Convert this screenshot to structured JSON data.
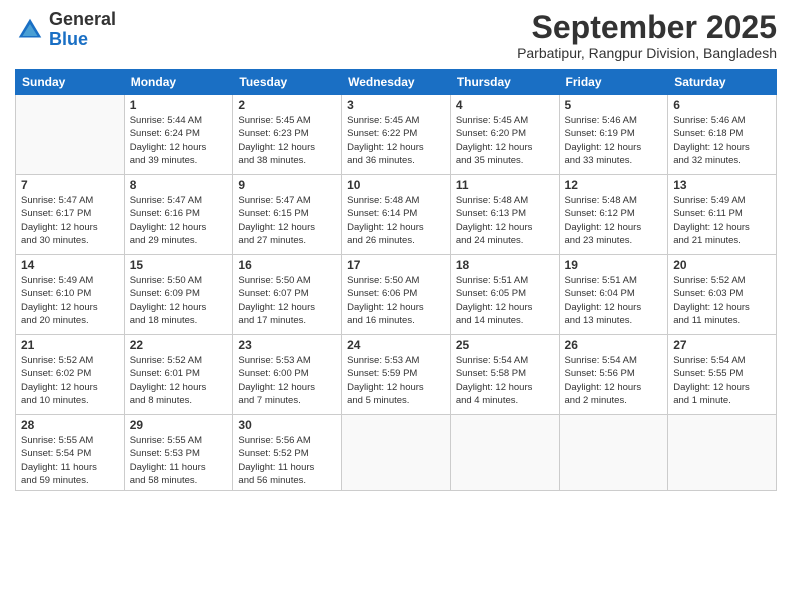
{
  "logo": {
    "general": "General",
    "blue": "Blue"
  },
  "title": "September 2025",
  "location": "Parbatipur, Rangpur Division, Bangladesh",
  "days_header": [
    "Sunday",
    "Monday",
    "Tuesday",
    "Wednesday",
    "Thursday",
    "Friday",
    "Saturday"
  ],
  "weeks": [
    [
      {
        "day": "",
        "info": ""
      },
      {
        "day": "1",
        "info": "Sunrise: 5:44 AM\nSunset: 6:24 PM\nDaylight: 12 hours\nand 39 minutes."
      },
      {
        "day": "2",
        "info": "Sunrise: 5:45 AM\nSunset: 6:23 PM\nDaylight: 12 hours\nand 38 minutes."
      },
      {
        "day": "3",
        "info": "Sunrise: 5:45 AM\nSunset: 6:22 PM\nDaylight: 12 hours\nand 36 minutes."
      },
      {
        "day": "4",
        "info": "Sunrise: 5:45 AM\nSunset: 6:20 PM\nDaylight: 12 hours\nand 35 minutes."
      },
      {
        "day": "5",
        "info": "Sunrise: 5:46 AM\nSunset: 6:19 PM\nDaylight: 12 hours\nand 33 minutes."
      },
      {
        "day": "6",
        "info": "Sunrise: 5:46 AM\nSunset: 6:18 PM\nDaylight: 12 hours\nand 32 minutes."
      }
    ],
    [
      {
        "day": "7",
        "info": "Sunrise: 5:47 AM\nSunset: 6:17 PM\nDaylight: 12 hours\nand 30 minutes."
      },
      {
        "day": "8",
        "info": "Sunrise: 5:47 AM\nSunset: 6:16 PM\nDaylight: 12 hours\nand 29 minutes."
      },
      {
        "day": "9",
        "info": "Sunrise: 5:47 AM\nSunset: 6:15 PM\nDaylight: 12 hours\nand 27 minutes."
      },
      {
        "day": "10",
        "info": "Sunrise: 5:48 AM\nSunset: 6:14 PM\nDaylight: 12 hours\nand 26 minutes."
      },
      {
        "day": "11",
        "info": "Sunrise: 5:48 AM\nSunset: 6:13 PM\nDaylight: 12 hours\nand 24 minutes."
      },
      {
        "day": "12",
        "info": "Sunrise: 5:48 AM\nSunset: 6:12 PM\nDaylight: 12 hours\nand 23 minutes."
      },
      {
        "day": "13",
        "info": "Sunrise: 5:49 AM\nSunset: 6:11 PM\nDaylight: 12 hours\nand 21 minutes."
      }
    ],
    [
      {
        "day": "14",
        "info": "Sunrise: 5:49 AM\nSunset: 6:10 PM\nDaylight: 12 hours\nand 20 minutes."
      },
      {
        "day": "15",
        "info": "Sunrise: 5:50 AM\nSunset: 6:09 PM\nDaylight: 12 hours\nand 18 minutes."
      },
      {
        "day": "16",
        "info": "Sunrise: 5:50 AM\nSunset: 6:07 PM\nDaylight: 12 hours\nand 17 minutes."
      },
      {
        "day": "17",
        "info": "Sunrise: 5:50 AM\nSunset: 6:06 PM\nDaylight: 12 hours\nand 16 minutes."
      },
      {
        "day": "18",
        "info": "Sunrise: 5:51 AM\nSunset: 6:05 PM\nDaylight: 12 hours\nand 14 minutes."
      },
      {
        "day": "19",
        "info": "Sunrise: 5:51 AM\nSunset: 6:04 PM\nDaylight: 12 hours\nand 13 minutes."
      },
      {
        "day": "20",
        "info": "Sunrise: 5:52 AM\nSunset: 6:03 PM\nDaylight: 12 hours\nand 11 minutes."
      }
    ],
    [
      {
        "day": "21",
        "info": "Sunrise: 5:52 AM\nSunset: 6:02 PM\nDaylight: 12 hours\nand 10 minutes."
      },
      {
        "day": "22",
        "info": "Sunrise: 5:52 AM\nSunset: 6:01 PM\nDaylight: 12 hours\nand 8 minutes."
      },
      {
        "day": "23",
        "info": "Sunrise: 5:53 AM\nSunset: 6:00 PM\nDaylight: 12 hours\nand 7 minutes."
      },
      {
        "day": "24",
        "info": "Sunrise: 5:53 AM\nSunset: 5:59 PM\nDaylight: 12 hours\nand 5 minutes."
      },
      {
        "day": "25",
        "info": "Sunrise: 5:54 AM\nSunset: 5:58 PM\nDaylight: 12 hours\nand 4 minutes."
      },
      {
        "day": "26",
        "info": "Sunrise: 5:54 AM\nSunset: 5:56 PM\nDaylight: 12 hours\nand 2 minutes."
      },
      {
        "day": "27",
        "info": "Sunrise: 5:54 AM\nSunset: 5:55 PM\nDaylight: 12 hours\nand 1 minute."
      }
    ],
    [
      {
        "day": "28",
        "info": "Sunrise: 5:55 AM\nSunset: 5:54 PM\nDaylight: 11 hours\nand 59 minutes."
      },
      {
        "day": "29",
        "info": "Sunrise: 5:55 AM\nSunset: 5:53 PM\nDaylight: 11 hours\nand 58 minutes."
      },
      {
        "day": "30",
        "info": "Sunrise: 5:56 AM\nSunset: 5:52 PM\nDaylight: 11 hours\nand 56 minutes."
      },
      {
        "day": "",
        "info": ""
      },
      {
        "day": "",
        "info": ""
      },
      {
        "day": "",
        "info": ""
      },
      {
        "day": "",
        "info": ""
      }
    ]
  ]
}
